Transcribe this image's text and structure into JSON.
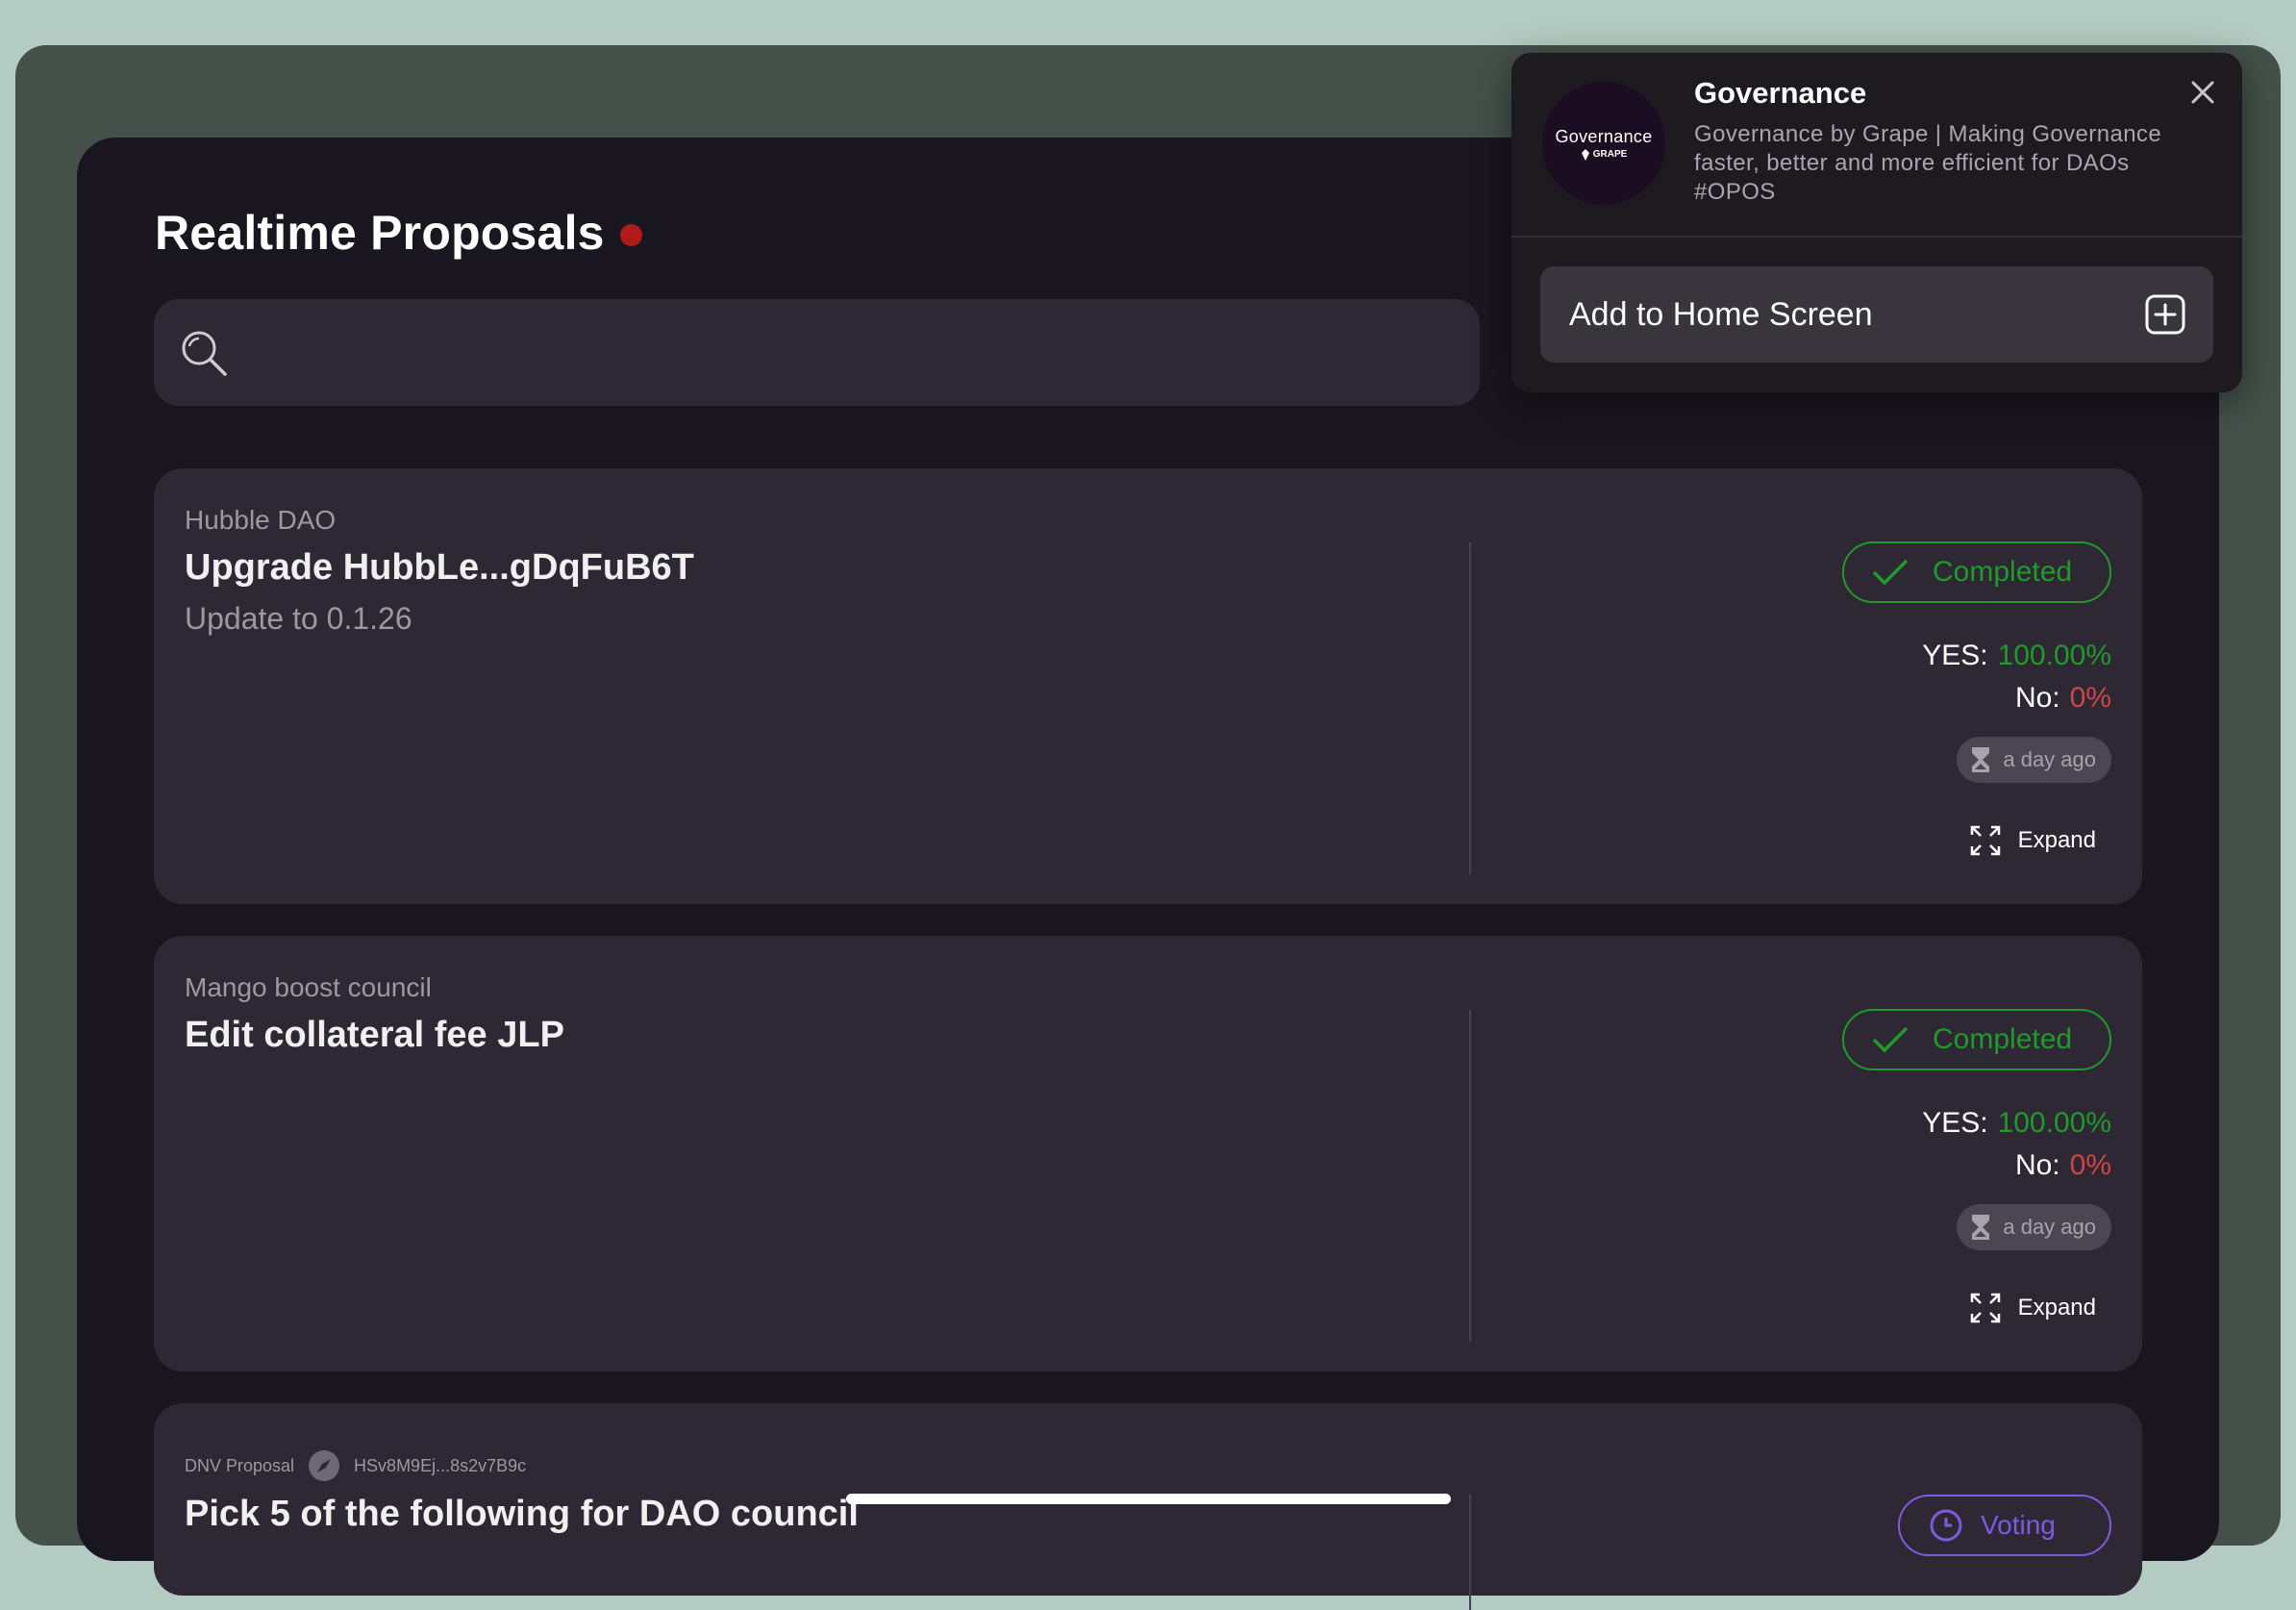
{
  "page": {
    "title": "Realtime Proposals",
    "search_placeholder": ""
  },
  "proposals": [
    {
      "dao": "Hubble DAO",
      "title": "Upgrade HubbLe...gDqFuB6T",
      "description": "Update to 0.1.26",
      "status": "Completed",
      "yes_label": "YES:",
      "yes_value": "100.00%",
      "no_label": "No:",
      "no_value": "0%",
      "time": "a day ago",
      "expand_label": "Expand"
    },
    {
      "dao": "Mango boost council",
      "title": "Edit collateral fee JLP",
      "description": "",
      "status": "Completed",
      "yes_label": "YES:",
      "yes_value": "100.00%",
      "no_label": "No:",
      "no_value": "0%",
      "time": "a day ago",
      "expand_label": "Expand"
    },
    {
      "dao": "DNV Proposal",
      "address": "HSv8M9Ej...8s2v7B9c",
      "title": "Pick 5 of the following for DAO council",
      "status": "Voting"
    }
  ],
  "popover": {
    "app_name": "Governance",
    "app_description": "Governance by Grape | Making Governance faster, better and more efficient for DAOs #OPOS",
    "logo_text": "Governance",
    "logo_subtext": "GRAPE",
    "add_home_label": "Add to Home Screen"
  },
  "colors": {
    "completed": "#1f9b2a",
    "no_value": "#d04545",
    "live_dot": "#b21a1a",
    "voting": "#7b5ce0"
  }
}
